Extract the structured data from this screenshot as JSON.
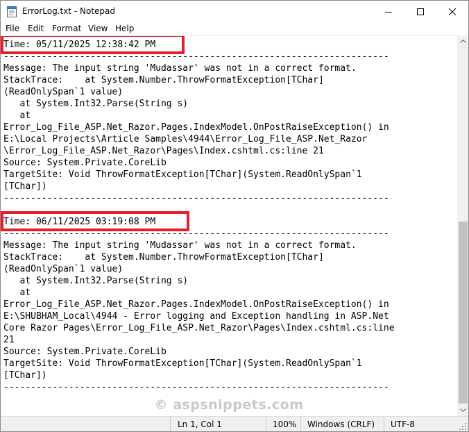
{
  "window": {
    "title": "ErrorLog.txt - Notepad"
  },
  "menu": {
    "items": [
      "File",
      "Edit",
      "Format",
      "View",
      "Help"
    ]
  },
  "editor": {
    "text": "Time: 05/11/2025 12:38:42 PM\n-----------------------------------------------------------------------\nMessage: The input string 'Mudassar' was not in a correct format.\nStackTrace:    at System.Number.ThrowFormatException[TChar]\n(ReadOnlySpan`1 value)\n   at System.Int32.Parse(String s)\n   at\nError_Log_File_ASP.Net_Razor.Pages.IndexModel.OnPostRaiseException() in\nE:\\Local Projects\\Article Samples\\4944\\Error_Log_File_ASP.Net_Razor\n\\Error_Log_File_ASP.Net_Razor\\Pages\\Index.cshtml.cs:line 21\nSource: System.Private.CoreLib\nTargetSite: Void ThrowFormatException[TChar](System.ReadOnlySpan`1\n[TChar])\n-----------------------------------------------------------------------\n\nTime: 06/11/2025 03:19:08 PM\n-----------------------------------------------------------------------\nMessage: The input string 'Mudassar' was not in a correct format.\nStackTrace:    at System.Number.ThrowFormatException[TChar]\n(ReadOnlySpan`1 value)\n   at System.Int32.Parse(String s)\n   at\nError_Log_File_ASP.Net_Razor.Pages.IndexModel.OnPostRaiseException() in\nE:\\SHUBHAM_Local\\4944 - Error logging and Exception handling in ASP.Net\nCore Razor Pages\\Error_Log_File_ASP.Net_Razor\\Pages\\Index.cshtml.cs:line\n21\nSource: System.Private.CoreLib\nTargetSite: Void ThrowFormatException[TChar](System.ReadOnlySpan`1\n[TChar])\n-----------------------------------------------------------------------"
  },
  "watermark": "© aspsnippets.com",
  "status": {
    "position": "Ln 1, Col 1",
    "zoom": "100%",
    "line_ending": "Windows (CRLF)",
    "encoding": "UTF-8"
  },
  "colors": {
    "highlight": "#e5202d",
    "scroll_thumb": "#c1c1c1"
  }
}
